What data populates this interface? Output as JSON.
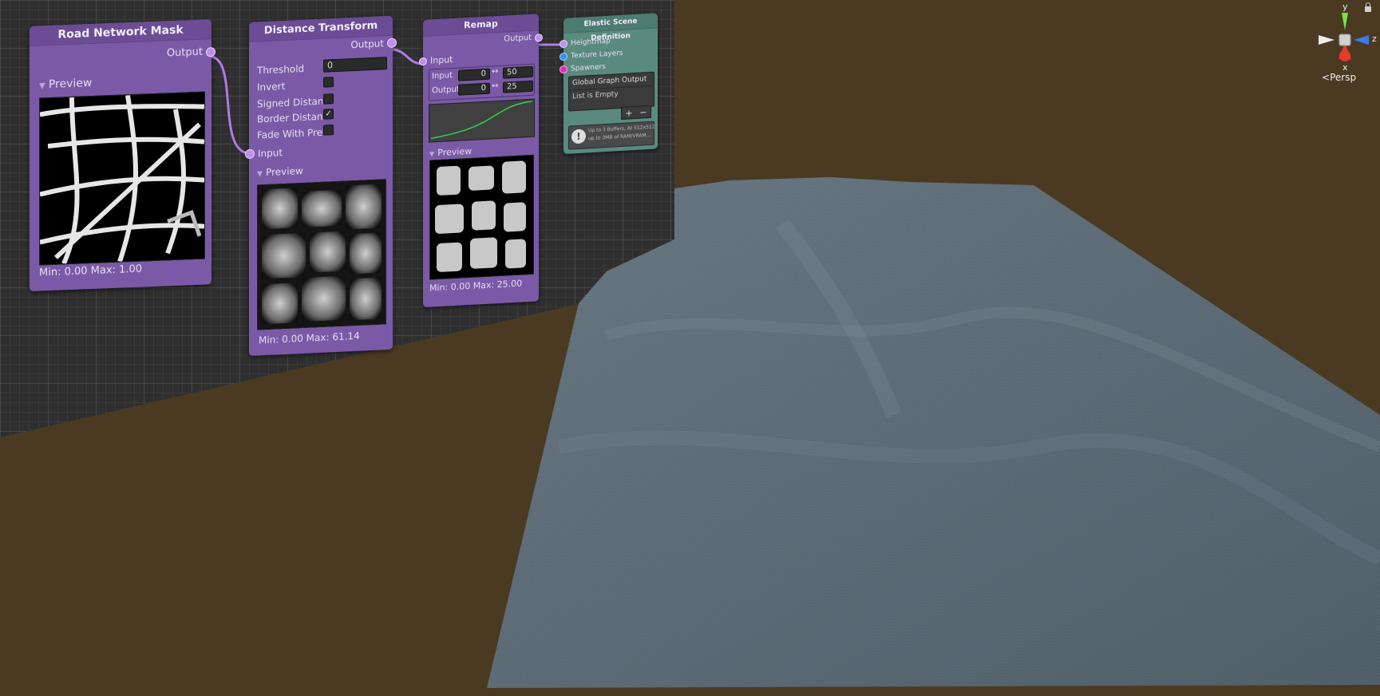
{
  "nodes": {
    "road_mask": {
      "title": "Road Network Mask",
      "output_label": "Output",
      "preview_label": "Preview",
      "minmax": "Min: 0.00 Max: 1.00"
    },
    "distance": {
      "title": "Distance Transform",
      "output_label": "Output",
      "input_label": "Input",
      "threshold_label": "Threshold",
      "threshold_value": "0",
      "invert_label": "Invert",
      "signed_label": "Signed Distanc",
      "border_label": "Border Distanc",
      "fade_label": "Fade With Prev",
      "preview_label": "Preview",
      "minmax": "Min: 0.00 Max: 61.14"
    },
    "remap": {
      "title": "Remap",
      "output_label": "Output",
      "input_label": "Input",
      "row_input_label": "Input",
      "row_input_min": "0",
      "row_input_max": "50",
      "row_output_label": "Output",
      "row_output_min": "0",
      "row_output_max": "25",
      "range_glyph": "↔",
      "preview_label": "Preview",
      "minmax": "Min: 0.00 Max: 25.00"
    },
    "elastic": {
      "title": "Elastic Scene Definition",
      "port_heightmap": "Heightmap",
      "port_texture": "Texture Layers",
      "port_spawners": "Spawners",
      "global_output": "Global Graph Output",
      "list_empty": "List is Empty",
      "add": "+",
      "remove": "−",
      "info_line1": "Up to 3 Buffers, At 512x512",
      "info_line2": "up to 3MB of RAM/VRAM..."
    }
  },
  "gizmo": {
    "x": "x",
    "y": "y",
    "z": "z",
    "view_mode": "Persp",
    "view_arrow": "<",
    "lock_icon": "lock-icon"
  },
  "colors": {
    "background": "#4a3a22",
    "node_purple": "#7a5aa6",
    "node_teal": "#5a8a7e",
    "terrain": "#5a6a76",
    "wire": "#b07ae6"
  }
}
